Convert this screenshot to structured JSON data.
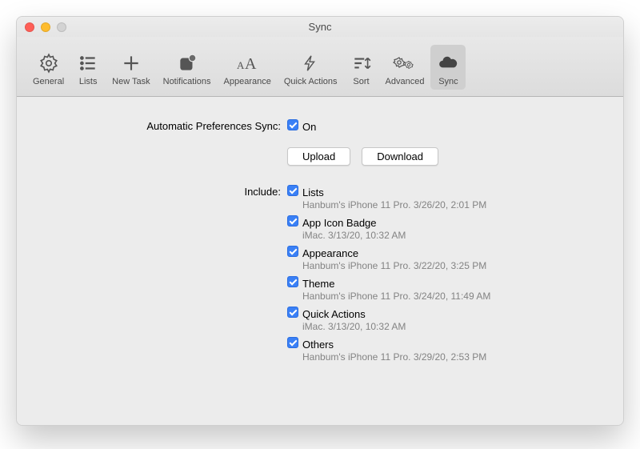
{
  "window": {
    "title": "Sync"
  },
  "toolbar": {
    "tabs": [
      {
        "label": "General"
      },
      {
        "label": "Lists"
      },
      {
        "label": "New Task"
      },
      {
        "label": "Notifications"
      },
      {
        "label": "Appearance"
      },
      {
        "label": "Quick Actions"
      },
      {
        "label": "Sort"
      },
      {
        "label": "Advanced"
      },
      {
        "label": "Sync"
      }
    ],
    "selected_index": 8
  },
  "main": {
    "auto_sync_label": "Automatic Preferences Sync:",
    "auto_sync_value_label": "On",
    "buttons": {
      "upload": "Upload",
      "download": "Download"
    },
    "include_label": "Include:",
    "include": [
      {
        "label": "Lists",
        "meta": "Hanbum's iPhone 11 Pro. 3/26/20, 2:01 PM"
      },
      {
        "label": "App Icon Badge",
        "meta": "iMac. 3/13/20, 10:32 AM"
      },
      {
        "label": "Appearance",
        "meta": "Hanbum's iPhone 11 Pro. 3/22/20, 3:25 PM"
      },
      {
        "label": "Theme",
        "meta": "Hanbum's iPhone 11 Pro. 3/24/20, 11:49 AM"
      },
      {
        "label": "Quick Actions",
        "meta": "iMac. 3/13/20, 10:32 AM"
      },
      {
        "label": "Others",
        "meta": "Hanbum's iPhone 11 Pro. 3/29/20, 2:53 PM"
      }
    ]
  }
}
